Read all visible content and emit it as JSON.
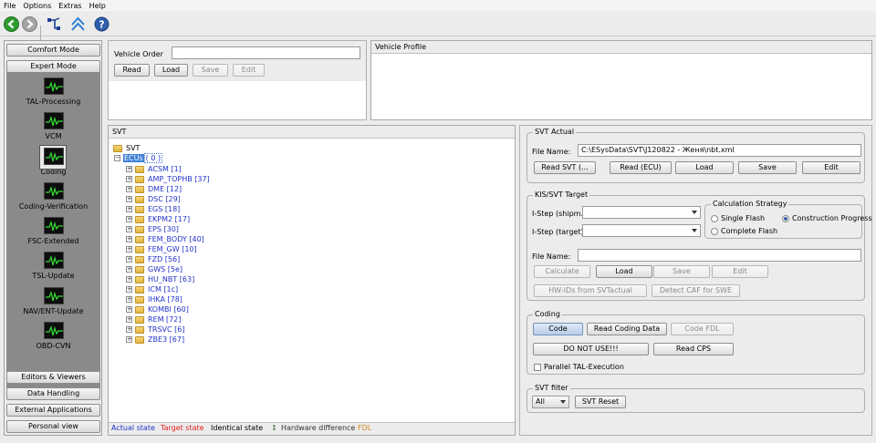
{
  "menu": [
    "File",
    "Options",
    "Extras",
    "Help"
  ],
  "toolbar": {
    "icons": [
      "back-icon",
      "forward-icon",
      "connection-icon",
      "network-icon",
      "help-icon"
    ]
  },
  "nav": {
    "top_buttons": [
      "Comfort Mode",
      "Expert Mode"
    ],
    "tools": [
      "TAL-Processing",
      "VCM",
      "Coding",
      "Coding-Verification",
      "FSC-Extended",
      "TSL-Update",
      "NAV/ENT-Update",
      "OBD-CVN"
    ],
    "selected_tool": "Coding",
    "bottom_buttons": [
      "Editors & Viewers",
      "Data Handling",
      "External Applications",
      "Personal view"
    ]
  },
  "vehicle_order": {
    "label": "Vehicle Order",
    "value": "",
    "read": "Read",
    "load": "Load",
    "save": "Save",
    "edit": "Edit"
  },
  "vehicle_profile": {
    "title": "Vehicle Profile"
  },
  "svt": {
    "title": "SVT",
    "root": "SVT",
    "ecus_label": "ECUs",
    "ecus_count": "( 0 )",
    "items": [
      "ACSM [1]",
      "AMP_TOPHB [37]",
      "DME [12]",
      "DSC [29]",
      "EGS [18]",
      "EKPM2 [17]",
      "EPS [30]",
      "FEM_BODY [40]",
      "FEM_GW [10]",
      "FZD [56]",
      "GWS [5e]",
      "HU_NBT [63]",
      "ICM [1c]",
      "IHKA [78]",
      "KOMBI [60]",
      "REM [72]",
      "TRSVC [6]",
      "ZBE3 [67]"
    ],
    "legend": {
      "actual": "Actual state",
      "target": "Target state",
      "identical": "Identical state",
      "hw_symbol": "↕",
      "hardware": "Hardware difference",
      "fdl": "FDL"
    },
    "colors": {
      "actual": "#1f33cc",
      "target": "#e02020",
      "identical": "#000000",
      "hardware": "#2e6b2e",
      "fdl": "#d08a20"
    }
  },
  "svt_actual": {
    "title": "SVT Actual",
    "file_label": "File Name:",
    "file_value": "C:\\ESysData\\SVT\\J120822 - Женя\\nbt.xml",
    "buttons": [
      "Read SVT (...",
      "Read (ECU)",
      "Load",
      "Save",
      "Edit"
    ]
  },
  "kis_target": {
    "title": "KIS/SVT Target",
    "istep_shipm": "I-Step (shipm.):",
    "istep_target": "I-Step (target):",
    "calc_title": "Calculation Strategy",
    "single_flash": "Single Flash",
    "construction_progress": "Construction Progress",
    "complete_flash": "Complete Flash",
    "selected_strategy": "Construction Progress",
    "file_label": "File Name:",
    "file_value": "",
    "buttons": [
      "Calculate",
      "Load",
      "Save",
      "Edit"
    ],
    "hw_ids": "HW-IDs from SVTactual",
    "detect_caf": "Detect CAF for SWE"
  },
  "coding": {
    "title": "Coding",
    "code": "Code",
    "read_coding": "Read Coding Data",
    "code_fdl": "Code FDL",
    "do_not_use": "DO NOT USE!!!",
    "read_cps": "Read CPS",
    "parallel": "Parallel TAL-Execution"
  },
  "svt_filter": {
    "title": "SVT filter",
    "selected": "All",
    "reset": "SVT Reset"
  }
}
